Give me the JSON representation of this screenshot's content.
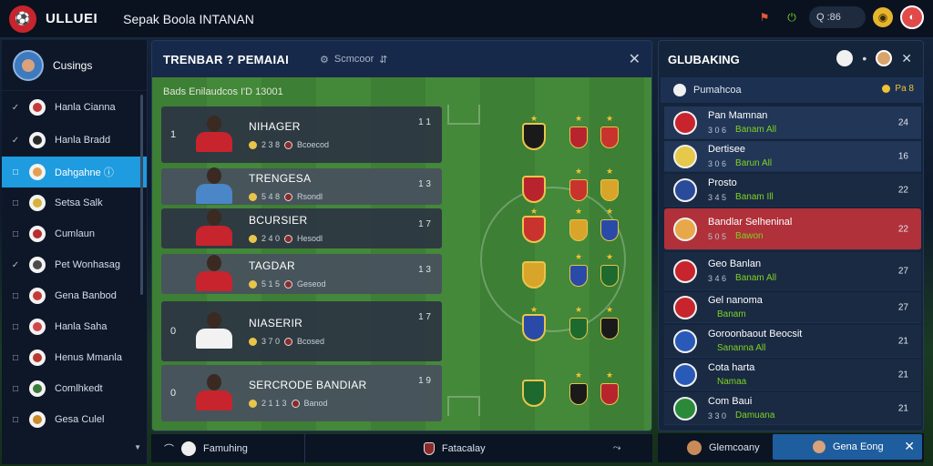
{
  "topbar": {
    "brand": "ULLUEI",
    "title": "Sepak Boola INTANAN",
    "search_label": "Q :86"
  },
  "sidebar": {
    "user": "Cusings",
    "items": [
      {
        "mark": "✓",
        "label": "Hanla Cianna",
        "color": "#c43a3a"
      },
      {
        "mark": "✓",
        "label": "Hanla Bradd",
        "color": "#2a2a2a"
      },
      {
        "mark": "□",
        "label": "Dahgahne ⓘ",
        "color": "#e3a052",
        "active": true
      },
      {
        "mark": "□",
        "label": "Setsa Salk",
        "color": "#d8b23a"
      },
      {
        "mark": "□",
        "label": "Cumlaun",
        "color": "#b82d2d"
      },
      {
        "mark": "✓",
        "label": "Pet Wonhasag",
        "color": "#4a4a4a"
      },
      {
        "mark": "□",
        "label": "Gena Banbod",
        "color": "#c43a3a"
      },
      {
        "mark": "□",
        "label": "Hanla Saha",
        "color": "#d04848"
      },
      {
        "mark": "□",
        "label": "Henus Mmanla",
        "color": "#b8392f"
      },
      {
        "mark": "□",
        "label": "Comlhkedt",
        "color": "#3a7a3a"
      },
      {
        "mark": "□",
        "label": "Gesa Culel",
        "color": "#c98a2a"
      }
    ]
  },
  "center": {
    "title": "TRENBAR ? PEMAIAI",
    "subtitle": "Scmcoor",
    "filter": "Bads Enilaudcos  I'D  13001",
    "players": [
      {
        "num": "1",
        "name": "NIHAGER",
        "meta": "2 3 8",
        "club": "Bcoecod",
        "score": "1 1",
        "shirt": "#c8242d"
      },
      {
        "num": "",
        "name": "TRENGESA",
        "meta": "5 4 8",
        "club": "Rsondl",
        "score": "1 3",
        "shirt": "#4a86c8"
      },
      {
        "num": "",
        "name": "BCURSIER",
        "meta": "2 4 0",
        "club": "Hesodl",
        "score": "1 7",
        "shirt": "#c8242d"
      },
      {
        "num": "",
        "name": "TAGDAR",
        "meta": "5 1 5",
        "club": "Geseod",
        "score": "1 3",
        "shirt": "#c8242d"
      },
      {
        "num": "0",
        "name": "NIASERIR",
        "meta": "3 7 0",
        "club": "Bcosed",
        "score": "1 7",
        "shirt": "#f2f2f2"
      },
      {
        "num": "0",
        "name": "SERCRODE BANDIAR",
        "meta": "2 1 1 3",
        "club": "Banod",
        "score": "1 9",
        "shirt": "#c8242d"
      }
    ]
  },
  "bottombar": {
    "left": "Famuhing",
    "middle": "Fatacalay"
  },
  "right": {
    "title": "GLUBAKING",
    "sub_left": "Pumahcoa",
    "sub_right": "Pa 8",
    "rows": [
      {
        "name": "Pan Mamnan",
        "meta": "3 0 6",
        "tag": "Banam All",
        "score": "24",
        "crest": "#c8242d",
        "style": "mid"
      },
      {
        "name": "Dertisee",
        "meta": "3 0 6",
        "tag": "Barun All",
        "score": "16",
        "crest": "#e6c84a",
        "style": "mid"
      },
      {
        "name": "Prosto",
        "meta": "3 4 5",
        "tag": "Banam Ill",
        "score": "22",
        "crest": "#2a4a9a",
        "style": "dark"
      },
      {
        "name": "Bandlar Selheninal",
        "meta": "5 0 5",
        "tag": "Bawon",
        "score": "22",
        "crest": "#e8a84a",
        "style": "hl"
      },
      {
        "name": "Geo Banlan",
        "meta": "3 4 6",
        "tag": "Banam All",
        "score": "27",
        "crest": "#c8242d",
        "style": "dark"
      },
      {
        "name": "Gel nanoma",
        "meta": "",
        "tag": "Banam",
        "score": "27",
        "crest": "#c8242d",
        "style": "dark"
      },
      {
        "name": "Goroonbaout Beocsit",
        "meta": "",
        "tag": "Sananna All",
        "score": "21",
        "crest": "#2a5ab8",
        "style": "dark"
      },
      {
        "name": "Cota harta",
        "meta": "",
        "tag": "Namaa",
        "score": "21",
        "crest": "#2a5ab8",
        "style": "dark"
      },
      {
        "name": "Com Baui",
        "meta": "3 3 0",
        "tag": "Damuana",
        "score": "21",
        "crest": "#2a8a3a",
        "style": "dark"
      }
    ]
  },
  "right_bottom": {
    "left": "Glemcoany",
    "button": "Gena Eong"
  },
  "colors": {
    "accent": "#1f9be0",
    "highlight": "#b0313a",
    "pitch": "#3d7f34"
  }
}
